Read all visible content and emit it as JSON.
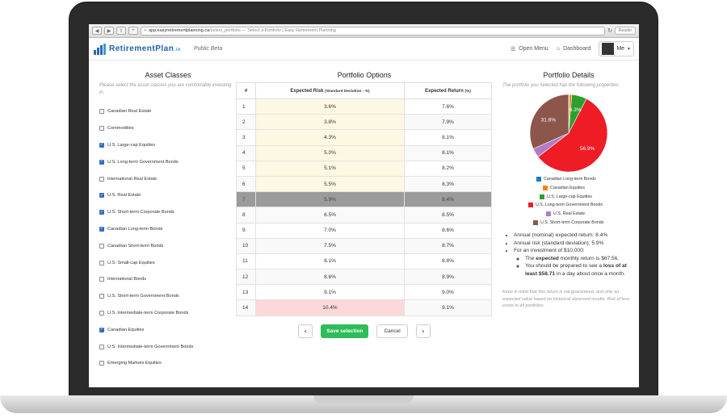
{
  "browser": {
    "url_host": "app.easyretirementplanning.ca",
    "url_rest": "/select_portfolio — Select a Portfolio | Easy Retirement Planning",
    "reader_label": "Reader"
  },
  "navbar": {
    "logo": "RetirementPlan",
    "logo_suffix": ".io",
    "beta_label": "Public Beta",
    "menu_label": "Open Menu",
    "dashboard_label": "Dashboard",
    "user_label": "Me"
  },
  "asset_classes": {
    "title": "Asset Classes",
    "hint": "Please select the asset classes you are comfortable investing in.",
    "items": [
      {
        "label": "Canadian Real Estate",
        "checked": false
      },
      {
        "label": "Commodities",
        "checked": false
      },
      {
        "label": "U.S. Large-cap Equities",
        "checked": true
      },
      {
        "label": "U.S. Long-term Government Bonds",
        "checked": true
      },
      {
        "label": "International Real Estate",
        "checked": false
      },
      {
        "label": "U.S. Real Estate",
        "checked": true
      },
      {
        "label": "U.S. Short-term Corporate Bonds",
        "checked": true
      },
      {
        "label": "Canadian Long-term Bonds",
        "checked": true
      },
      {
        "label": "Canadian Short-term Bonds",
        "checked": false
      },
      {
        "label": "U.S. Small-cap Equities",
        "checked": false
      },
      {
        "label": "International Bonds",
        "checked": false
      },
      {
        "label": "U.S. Short-term Government Bonds",
        "checked": false
      },
      {
        "label": "U.S. Intermediate-term Corporate Bonds",
        "checked": false
      },
      {
        "label": "Canadian Equities",
        "checked": true
      },
      {
        "label": "U.S. Intermediate-term Government Bonds",
        "checked": false
      },
      {
        "label": "Emerging Markets Equities",
        "checked": false
      }
    ]
  },
  "portfolio_options": {
    "title": "Portfolio Options",
    "col_num": "#",
    "col_risk": "Expected Risk",
    "col_risk_small": "(Standard Deviation - %)",
    "col_return": "Expected Return",
    "col_return_small": "(%)",
    "selected_index": 7,
    "rows": [
      {
        "n": "1",
        "risk": "3.6%",
        "ret": "7.6%"
      },
      {
        "n": "2",
        "risk": "3.8%",
        "ret": "7.9%"
      },
      {
        "n": "3",
        "risk": "4.3%",
        "ret": "8.1%"
      },
      {
        "n": "4",
        "risk": "5.0%",
        "ret": "8.1%"
      },
      {
        "n": "5",
        "risk": "5.1%",
        "ret": "8.2%"
      },
      {
        "n": "6",
        "risk": "5.5%",
        "ret": "8.3%"
      },
      {
        "n": "7",
        "risk": "5.9%",
        "ret": "8.4%"
      },
      {
        "n": "8",
        "risk": "6.5%",
        "ret": "8.5%"
      },
      {
        "n": "9",
        "risk": "7.0%",
        "ret": "8.6%"
      },
      {
        "n": "10",
        "risk": "7.5%",
        "ret": "8.7%"
      },
      {
        "n": "11",
        "risk": "8.1%",
        "ret": "8.8%"
      },
      {
        "n": "12",
        "risk": "8.6%",
        "ret": "8.9%"
      },
      {
        "n": "13",
        "risk": "9.1%",
        "ret": "9.0%"
      },
      {
        "n": "14",
        "risk": "10.4%",
        "ret": "9.1%"
      }
    ],
    "save_label": "Save selection",
    "cancel_label": "Cancel"
  },
  "details": {
    "title": "Portfolio Details",
    "hint": "The portfolio you selected has the following properties:",
    "pie": [
      {
        "name": "Canadian Long-term Bonds",
        "color": "#1f77c9",
        "value": 0.3
      },
      {
        "name": "Canadian Equities",
        "color": "#ff7f0e",
        "value": 1.0
      },
      {
        "name": "U.S. Large-cap Equities",
        "color": "#2ca02c",
        "value": 6.3
      },
      {
        "name": "U.S. Long-term Government Bonds",
        "color": "#ee1c25",
        "value": 56.9
      },
      {
        "name": "U.S. Real Estate",
        "color": "#b07cc6",
        "value": 3.9
      },
      {
        "name": "U.S. Short-term Corporate Bonds",
        "color": "#8c564b",
        "value": 31.6
      }
    ],
    "pie_labels": {
      "red": "56.9%",
      "brown": "31.6%",
      "green": "6.3%"
    },
    "bullet1": "Annual (nominal) expected return: 8.4%",
    "bullet2": "Annual risk (standard deviation): 5.9%",
    "bullet3": "For an investment of $10,000:",
    "sub1_pre": "The ",
    "sub1_bold": "expected",
    "sub1_post": " monthly return is $67.56.",
    "sub2_pre": "You should be prepared to see a ",
    "sub2_bold": "loss of at least $58.71",
    "sub2_post": " in a day about once a month.",
    "disclaimer": "Keep in mind that this return is not guaranteed, and only an expected value based on historical observed results. Risk of loss exists in all portfolios."
  }
}
